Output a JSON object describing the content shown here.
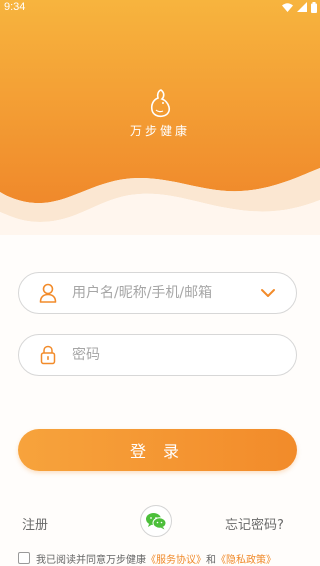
{
  "status_bar": {
    "time": "9:34",
    "icons": [
      "wifi-icon",
      "signal-icon",
      "battery-icon"
    ]
  },
  "app": {
    "name": "万步健康",
    "logo_icon": "rabbit-logo-icon"
  },
  "form": {
    "username_placeholder": "用户名/昵称/手机/邮箱",
    "username_icon": "user-icon",
    "dropdown_icon": "chevron-down-icon",
    "password_placeholder": "密码",
    "password_icon": "lock-icon",
    "login_label": "登 录"
  },
  "links": {
    "register": "注册",
    "forgot_password": "忘记密码?",
    "wechat_icon": "wechat-icon"
  },
  "agreement": {
    "prefix": "我已阅读并同意万步健康",
    "service": "《服务协议》",
    "and": "和",
    "privacy": "《隐私政策》"
  },
  "colors": {
    "accent": "#f28b2a",
    "header_top": "#f7b43e",
    "header_bottom": "#f0892b",
    "background": "#fffdfb"
  }
}
